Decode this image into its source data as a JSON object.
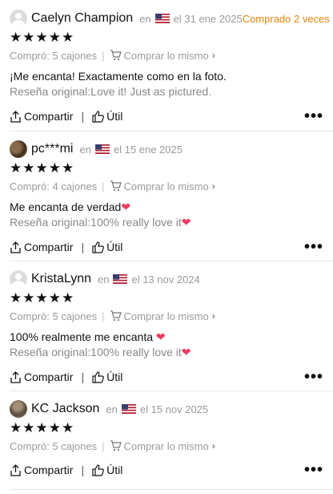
{
  "reviews": [
    {
      "name": "Caelyn Champion",
      "en": "en",
      "flag": "us-flag-icon",
      "date": "el 31 ene 2025",
      "badge": "Comprado 2 veces",
      "stars": "★★★★★",
      "rating": 5,
      "bought": "Compró: 5 cajones",
      "buy_same": "Comprar lo mismo",
      "text": "¡Me encanta! Exactamente como en la foto.",
      "heart": "",
      "original": "Reseña original:Love it! Just as pictured.",
      "original_heart": "",
      "share": "Compartir",
      "useful": "Útil"
    },
    {
      "name": "pc***mi",
      "en": "en",
      "flag": "us-flag-icon",
      "date": "el 15 ene 2025",
      "badge": "",
      "stars": "★★★★★",
      "rating": 5,
      "bought": "Compró: 4 cajones",
      "buy_same": "Comprar lo mismo",
      "text": "Me encanta de verdad",
      "heart": "❤",
      "original": "Reseña original:100% really love it",
      "original_heart": "❤",
      "share": "Compartir",
      "useful": "Útil"
    },
    {
      "name": "KristaLynn",
      "en": "en",
      "flag": "us-flag-icon",
      "date": "el 13 nov 2024",
      "badge": "",
      "stars": "★★★★★",
      "rating": 5,
      "bought": "Compró: 5 cajones",
      "buy_same": "Comprar lo mismo",
      "text": "100% realmente me encanta ",
      "heart": "❤",
      "original": "Reseña original:100% really love it",
      "original_heart": "❤",
      "share": "Compartir",
      "useful": "Útil"
    },
    {
      "name": "KC Jackson",
      "en": "en",
      "flag": "us-flag-icon",
      "date": "el 15 nov 2025",
      "badge": "",
      "stars": "★★★★★",
      "rating": 5,
      "bought": "Compró: 5 cajones",
      "buy_same": "Comprar lo mismo",
      "text": "",
      "heart": "",
      "original": "",
      "original_heart": "",
      "share": "Compartir",
      "useful": "Útil"
    }
  ],
  "colors": {
    "badge": "#e8840c",
    "heart": "#ee3a62",
    "meta": "#9a9a9a"
  }
}
